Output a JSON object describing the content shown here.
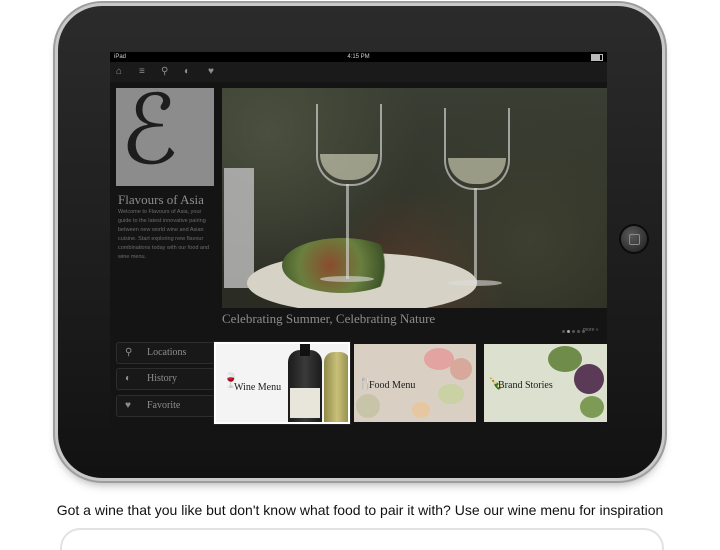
{
  "status_bar": {
    "device": "iPad",
    "time": "4:15 PM"
  },
  "nav_icons": [
    "home-icon",
    "list-icon",
    "location-icon",
    "history-icon",
    "heart-icon"
  ],
  "brand": {
    "title": "Flavours of Asia",
    "description": "Welcome to Flavours of Asia, your guide to the latest innovative pairing between new world wine and Asian cuisine. Start exploring new flavour combinations today with our food and wine menu."
  },
  "hero": {
    "caption": "Celebrating Summer, Celebrating Nature",
    "more_label": "more »",
    "slide_count": 5,
    "active_slide": 2
  },
  "side_menu": [
    {
      "label": "Locations",
      "icon": "pin-icon"
    },
    {
      "label": "History",
      "icon": "history-icon"
    },
    {
      "label": "Favorite",
      "icon": "heart-icon"
    }
  ],
  "tiles": [
    {
      "label": "Wine Menu",
      "icon": "wine-glass-icon",
      "selected": true
    },
    {
      "label": "Food Menu",
      "icon": "fork-knife-icon",
      "selected": false
    },
    {
      "label": "Brand Stories",
      "icon": "bottle-icon",
      "selected": false
    }
  ],
  "caption": "Got a wine that you like but don't know what food to pair it with? Use our wine menu for inspiration",
  "colors": {
    "screen_bg": "#141414",
    "frame": "#1c1c1c",
    "text_muted": "#8d8d8d"
  }
}
